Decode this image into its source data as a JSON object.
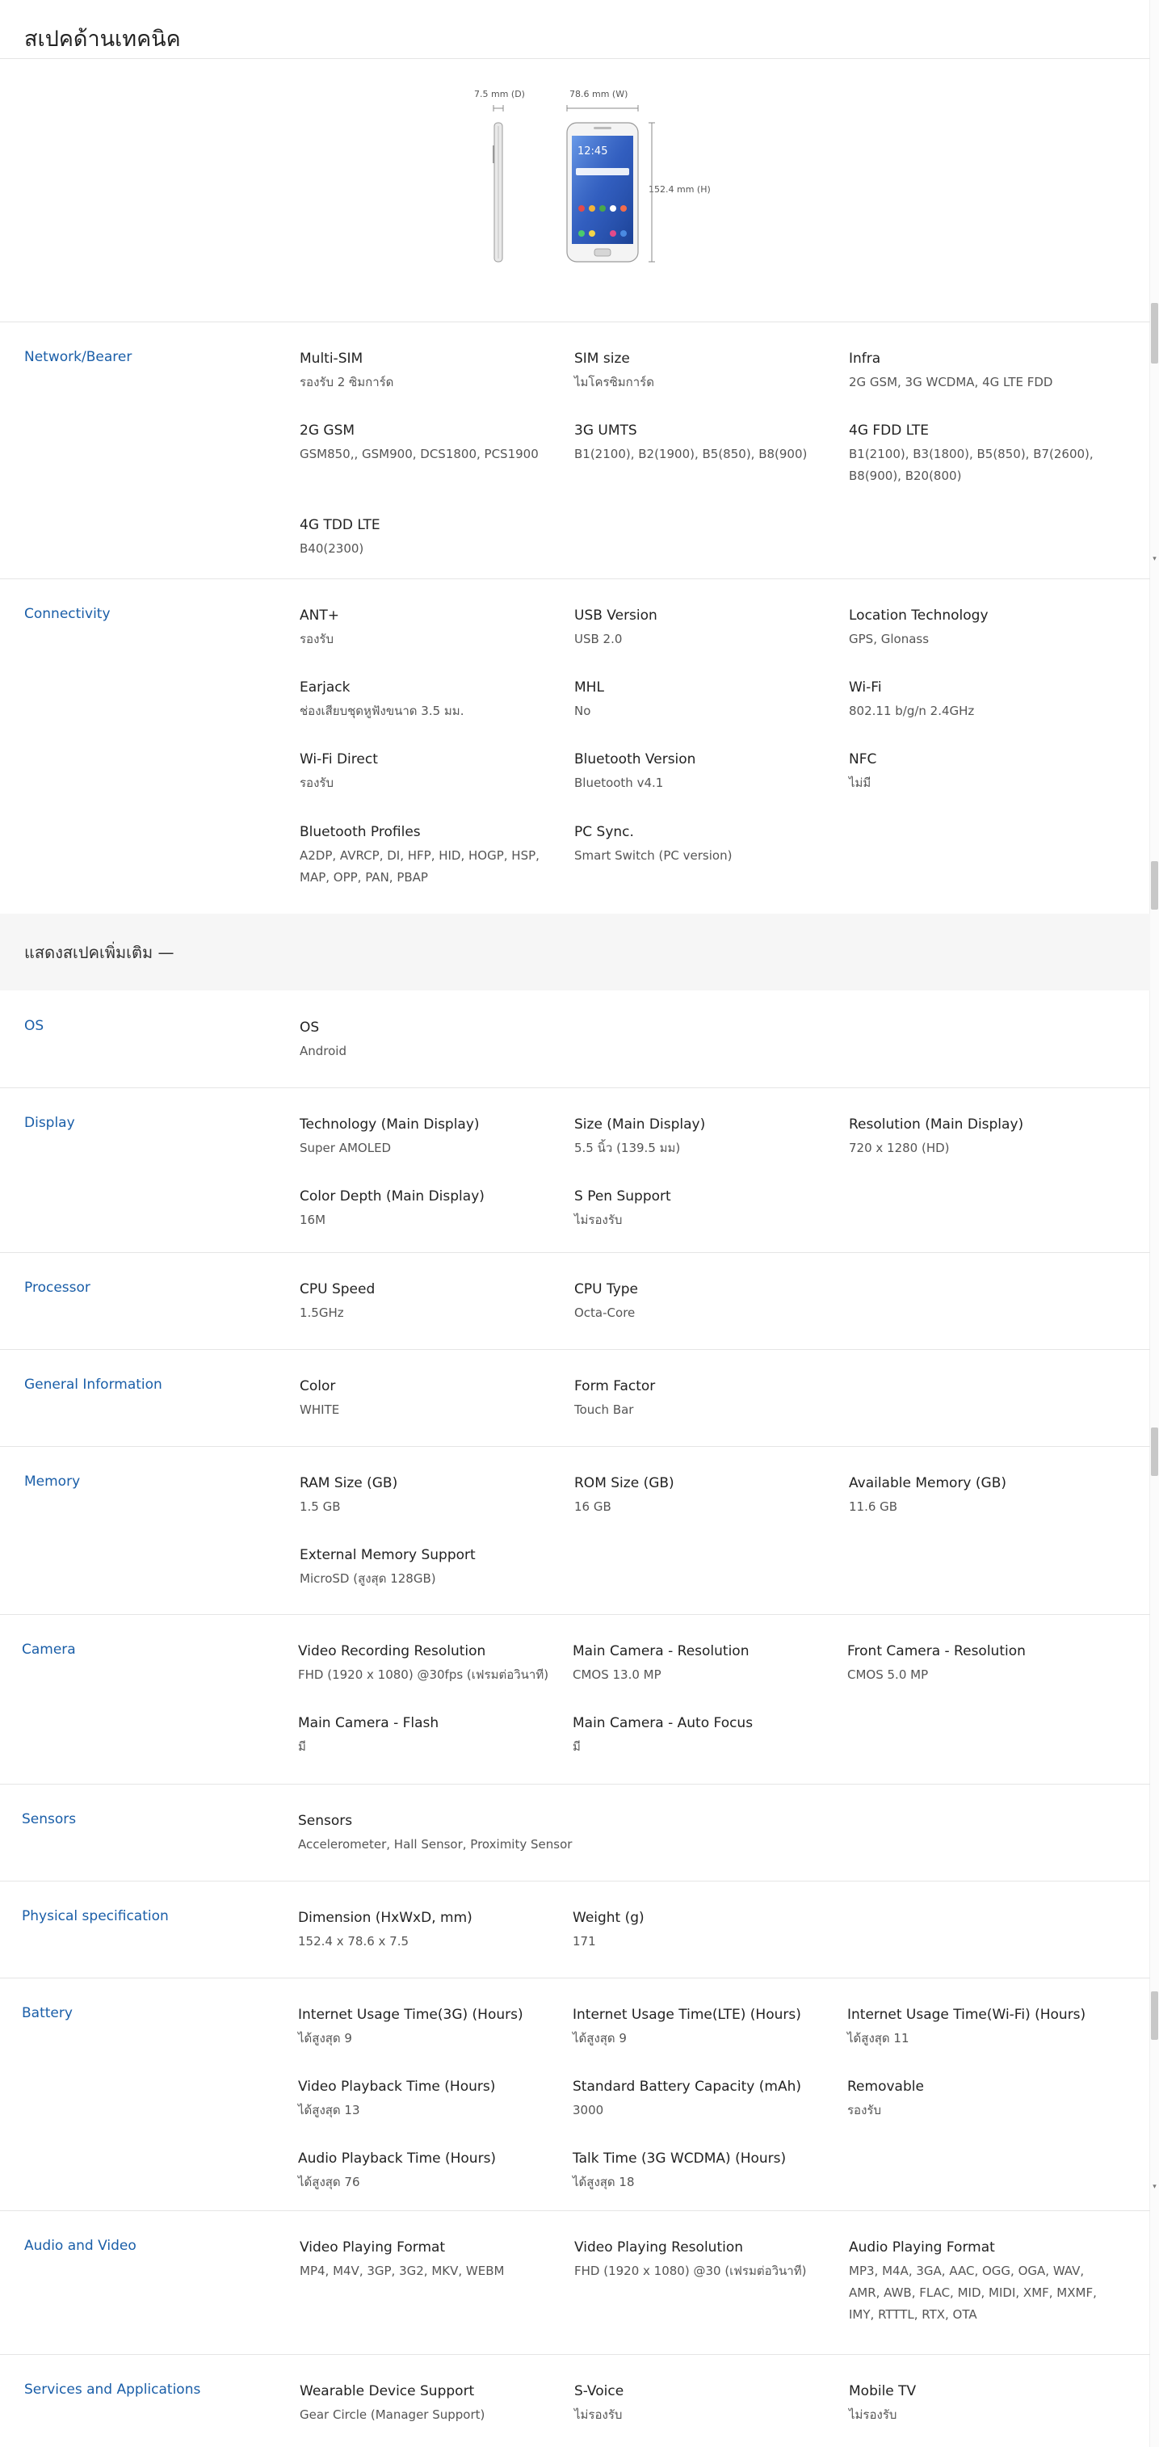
{
  "page_title": "สเปคด้านเทคนิค",
  "diagram": {
    "depth_label": "7.5 mm (D)",
    "width_label": "78.6 mm (W)",
    "height_label": "152.4 mm (H)",
    "phone_time": "12:45"
  },
  "show_more_label": "แสดงสเปคเพิ่มเติม —",
  "sections": {
    "network": {
      "title": "Network/Bearer",
      "specs": [
        {
          "label": "Multi-SIM",
          "value": "รองรับ 2 ซิมการ์ด"
        },
        {
          "label": "SIM size",
          "value": "ไมโครซิมการ์ด"
        },
        {
          "label": "Infra",
          "value": "2G GSM, 3G WCDMA, 4G LTE FDD"
        },
        {
          "label": "2G GSM",
          "value": "GSM850,, GSM900, DCS1800, PCS1900"
        },
        {
          "label": "3G UMTS",
          "value": "B1(2100), B2(1900), B5(850), B8(900)"
        },
        {
          "label": "4G FDD LTE",
          "value": "B1(2100), B3(1800), B5(850), B7(2600), B8(900), B20(800)"
        },
        {
          "label": "4G TDD LTE",
          "value": "B40(2300)"
        }
      ]
    },
    "connectivity": {
      "title": "Connectivity",
      "specs": [
        {
          "label": "ANT+",
          "value": "รองรับ"
        },
        {
          "label": "USB Version",
          "value": "USB 2.0"
        },
        {
          "label": "Location Technology",
          "value": "GPS, Glonass"
        },
        {
          "label": "Earjack",
          "value": "ช่องเสียบชุดหูฟังขนาด 3.5 มม."
        },
        {
          "label": "MHL",
          "value": "No"
        },
        {
          "label": "Wi-Fi",
          "value": "802.11 b/g/n 2.4GHz"
        },
        {
          "label": "Wi-Fi Direct",
          "value": "รองรับ"
        },
        {
          "label": "Bluetooth Version",
          "value": "Bluetooth v4.1"
        },
        {
          "label": "NFC",
          "value": "ไม่มี"
        },
        {
          "label": "Bluetooth Profiles",
          "value": "A2DP, AVRCP, DI, HFP, HID, HOGP, HSP, MAP, OPP, PAN, PBAP"
        },
        {
          "label": "PC Sync.",
          "value": "Smart Switch (PC version)"
        }
      ]
    },
    "os": {
      "title": "OS",
      "specs": [
        {
          "label": "OS",
          "value": "Android"
        }
      ]
    },
    "display": {
      "title": "Display",
      "specs": [
        {
          "label": "Technology (Main Display)",
          "value": "Super AMOLED"
        },
        {
          "label": "Size (Main Display)",
          "value": "5.5 นิ้ว (139.5 มม)"
        },
        {
          "label": "Resolution (Main Display)",
          "value": "720 x 1280 (HD)"
        },
        {
          "label": "Color Depth (Main Display)",
          "value": "16M"
        },
        {
          "label": "S Pen Support",
          "value": "ไม่รองรับ"
        }
      ]
    },
    "processor": {
      "title": "Processor",
      "specs": [
        {
          "label": "CPU Speed",
          "value": "1.5GHz"
        },
        {
          "label": "CPU Type",
          "value": "Octa-Core"
        }
      ]
    },
    "general": {
      "title": "General Information",
      "specs": [
        {
          "label": "Color",
          "value": "WHITE"
        },
        {
          "label": "Form Factor",
          "value": "Touch Bar"
        }
      ]
    },
    "memory": {
      "title": "Memory",
      "specs": [
        {
          "label": "RAM Size (GB)",
          "value": "1.5 GB"
        },
        {
          "label": "ROM Size (GB)",
          "value": "16 GB"
        },
        {
          "label": "Available Memory (GB)",
          "value": "11.6 GB"
        },
        {
          "label": "External Memory Support",
          "value": "MicroSD (สูงสุด 128GB)"
        }
      ]
    },
    "camera": {
      "title": "Camera",
      "specs": [
        {
          "label": "Video Recording Resolution",
          "value": "FHD (1920 x 1080) @30fps (เฟรมต่อวินาที)"
        },
        {
          "label": "Main Camera - Resolution",
          "value": "CMOS 13.0 MP"
        },
        {
          "label": "Front Camera - Resolution",
          "value": "CMOS 5.0 MP"
        },
        {
          "label": "Main Camera - Flash",
          "value": "มี"
        },
        {
          "label": "Main Camera - Auto Focus",
          "value": "มี"
        }
      ]
    },
    "sensors": {
      "title": "Sensors",
      "specs": [
        {
          "label": "Sensors",
          "value": "Accelerometer, Hall Sensor, Proximity Sensor"
        }
      ]
    },
    "physical": {
      "title": "Physical specification",
      "specs": [
        {
          "label": "Dimension (HxWxD, mm)",
          "value": "152.4 x 78.6 x 7.5"
        },
        {
          "label": "Weight (g)",
          "value": "171"
        }
      ]
    },
    "battery": {
      "title": "Battery",
      "specs": [
        {
          "label": "Internet Usage Time(3G) (Hours)",
          "value": "ได้สูงสุด 9"
        },
        {
          "label": "Internet Usage Time(LTE) (Hours)",
          "value": "ได้สูงสุด 9"
        },
        {
          "label": "Internet Usage Time(Wi-Fi) (Hours)",
          "value": "ได้สูงสุด 11"
        },
        {
          "label": "Video Playback Time (Hours)",
          "value": "ได้สูงสุด 13"
        },
        {
          "label": "Standard Battery Capacity (mAh)",
          "value": "3000"
        },
        {
          "label": "Removable",
          "value": "รองรับ"
        },
        {
          "label": "Audio Playback Time (Hours)",
          "value": "ได้สูงสุด 76"
        },
        {
          "label": "Talk Time (3G WCDMA) (Hours)",
          "value": "ได้สูงสุด 18"
        }
      ]
    },
    "audio_video": {
      "title": "Audio and Video",
      "specs": [
        {
          "label": "Video Playing Format",
          "value": "MP4, M4V, 3GP, 3G2, MKV, WEBM"
        },
        {
          "label": "Video Playing Resolution",
          "value": "FHD (1920 x 1080) @30 (เฟรมต่อวินาที)"
        },
        {
          "label": "Audio Playing Format",
          "value": "MP3, M4A, 3GA, AAC, OGG, OGA, WAV, AMR, AWB, FLAC, MID, MIDI, XMF, MXMF, IMY, RTTTL, RTX, OTA"
        }
      ]
    },
    "services": {
      "title": "Services and Applications",
      "specs": [
        {
          "label": "Wearable Device Support",
          "value": "Gear Circle (Manager Support)"
        },
        {
          "label": "S-Voice",
          "value": "ไม่รองรับ"
        },
        {
          "label": "Mobile TV",
          "value": "ไม่รองรับ"
        }
      ]
    }
  }
}
